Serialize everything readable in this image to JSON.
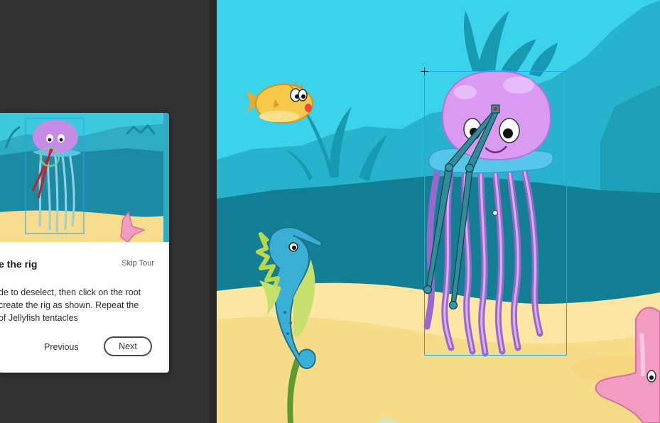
{
  "tour": {
    "title": "e the rig",
    "skip_label": "Skip Tour",
    "body_lines": [
      "de to deselect, then click on the root",
      "create the rig as shown. Repeat the",
      "of Jellyfish tentacles"
    ],
    "previous_label": "Previous",
    "next_label": "Next"
  },
  "colors": {
    "app_background": "#323232",
    "water": "#3ad3e9",
    "deep_water": "#127f95",
    "sand": "#f9e39a",
    "jellyfish": "#d69df2",
    "bone": "#2f8c98",
    "selection": "#1ea7e8"
  },
  "icons": [
    "transform-crosshair-icon",
    "bone-root-handle-icon",
    "bone-joint-icon",
    "registration-point-icon"
  ]
}
